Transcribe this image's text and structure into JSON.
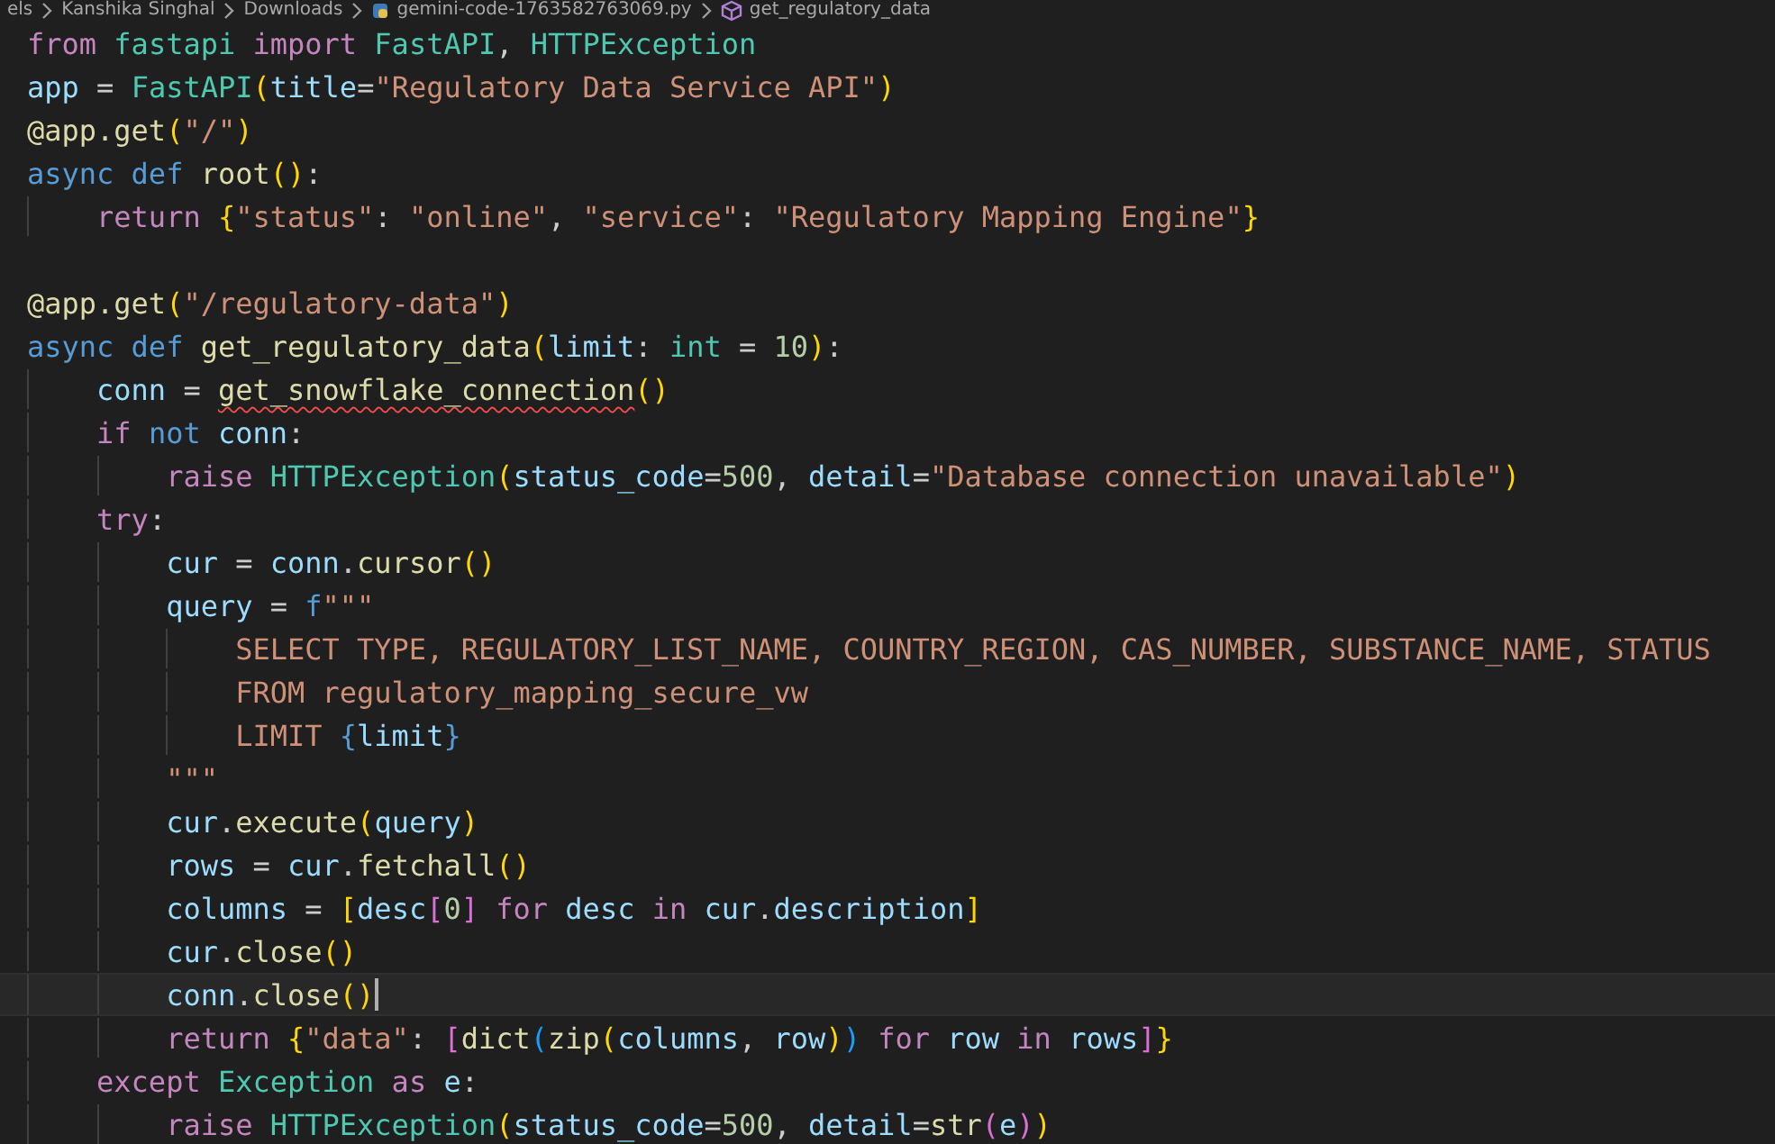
{
  "breadcrumb": [
    {
      "kind": "folder",
      "label": "els"
    },
    {
      "kind": "folder",
      "label": "Kanshika Singhal"
    },
    {
      "kind": "folder",
      "label": "Downloads"
    },
    {
      "kind": "file",
      "label": "gemini-code-1763582763069.py"
    },
    {
      "kind": "symbol",
      "label": "get_regulatory_data"
    }
  ],
  "editor": {
    "lines": [
      {
        "tokens": [
          {
            "kind": "kw",
            "text": "from "
          },
          {
            "kind": "ty",
            "text": "fastapi "
          },
          {
            "kind": "kw",
            "text": "import "
          },
          {
            "kind": "ty",
            "text": "FastAPI"
          },
          {
            "kind": "p",
            "text": ", "
          },
          {
            "kind": "ty",
            "text": "HTTPException"
          }
        ]
      },
      {
        "tokens": [
          {
            "kind": "var",
            "text": "app"
          },
          {
            "kind": "p",
            "text": " = "
          },
          {
            "kind": "ty",
            "text": "FastAPI"
          },
          {
            "kind": "b1",
            "text": "("
          },
          {
            "kind": "var",
            "text": "title"
          },
          {
            "kind": "p",
            "text": "="
          },
          {
            "kind": "str",
            "text": "\"Regulatory Data Service API\""
          },
          {
            "kind": "b1",
            "text": ")"
          }
        ]
      },
      {
        "tokens": [
          {
            "kind": "fn",
            "text": "@app.get"
          },
          {
            "kind": "b1",
            "text": "("
          },
          {
            "kind": "str",
            "text": "\"/\""
          },
          {
            "kind": "b1",
            "text": ")"
          }
        ]
      },
      {
        "tokens": [
          {
            "kind": "st",
            "text": "async def "
          },
          {
            "kind": "fn",
            "text": "root"
          },
          {
            "kind": "b1",
            "text": "()"
          },
          {
            "kind": "p",
            "text": ":"
          }
        ],
        "children": [
          {
            "tokens": [
              {
                "kind": "kw",
                "text": "return "
              },
              {
                "kind": "b1",
                "text": "{"
              },
              {
                "kind": "str",
                "text": "\"status\""
              },
              {
                "kind": "p",
                "text": ": "
              },
              {
                "kind": "str",
                "text": "\"online\""
              },
              {
                "kind": "p",
                "text": ", "
              },
              {
                "kind": "str",
                "text": "\"service\""
              },
              {
                "kind": "p",
                "text": ": "
              },
              {
                "kind": "str",
                "text": "\"Regulatory Mapping Engine\""
              },
              {
                "kind": "b1",
                "text": "}"
              }
            ]
          }
        ]
      },
      {
        "gap_before": true,
        "tokens": [
          {
            "kind": "fn",
            "text": "@app.get"
          },
          {
            "kind": "b1",
            "text": "("
          },
          {
            "kind": "str",
            "text": "\"/regulatory-data\""
          },
          {
            "kind": "b1",
            "text": ")"
          }
        ]
      },
      {
        "tokens": [
          {
            "kind": "st",
            "text": "async def "
          },
          {
            "kind": "fn",
            "text": "get_regulatory_data"
          },
          {
            "kind": "b1",
            "text": "("
          },
          {
            "kind": "var",
            "text": "limit"
          },
          {
            "kind": "p",
            "text": ": "
          },
          {
            "kind": "ty",
            "text": "int"
          },
          {
            "kind": "p",
            "text": " = "
          },
          {
            "kind": "num",
            "text": "10"
          },
          {
            "kind": "b1",
            "text": ")"
          },
          {
            "kind": "p",
            "text": ":"
          }
        ],
        "children": [
          {
            "tokens": [
              {
                "kind": "var",
                "text": "conn"
              },
              {
                "kind": "p",
                "text": " = "
              },
              {
                "kind": "fn",
                "text": "get_snowflake_connection",
                "squiggle": true
              },
              {
                "kind": "b1",
                "text": "()"
              }
            ]
          },
          {
            "tokens": [
              {
                "kind": "kw",
                "text": "if "
              },
              {
                "kind": "st",
                "text": "not "
              },
              {
                "kind": "var",
                "text": "conn"
              },
              {
                "kind": "p",
                "text": ":"
              }
            ],
            "children": [
              {
                "tokens": [
                  {
                    "kind": "kw",
                    "text": "raise "
                  },
                  {
                    "kind": "ty",
                    "text": "HTTPException"
                  },
                  {
                    "kind": "b1",
                    "text": "("
                  },
                  {
                    "kind": "var",
                    "text": "status_code"
                  },
                  {
                    "kind": "p",
                    "text": "="
                  },
                  {
                    "kind": "num",
                    "text": "500"
                  },
                  {
                    "kind": "p",
                    "text": ", "
                  },
                  {
                    "kind": "var",
                    "text": "detail"
                  },
                  {
                    "kind": "p",
                    "text": "="
                  },
                  {
                    "kind": "str",
                    "text": "\"Database connection unavailable\""
                  },
                  {
                    "kind": "b1",
                    "text": ")"
                  }
                ]
              }
            ]
          },
          {
            "tokens": [
              {
                "kind": "kw",
                "text": "try"
              },
              {
                "kind": "p",
                "text": ":"
              }
            ],
            "children": [
              {
                "tokens": [
                  {
                    "kind": "var",
                    "text": "cur"
                  },
                  {
                    "kind": "p",
                    "text": " = "
                  },
                  {
                    "kind": "var",
                    "text": "conn"
                  },
                  {
                    "kind": "p",
                    "text": "."
                  },
                  {
                    "kind": "fn",
                    "text": "cursor"
                  },
                  {
                    "kind": "b1",
                    "text": "()"
                  }
                ]
              },
              {
                "tokens": [
                  {
                    "kind": "var",
                    "text": "query"
                  },
                  {
                    "kind": "p",
                    "text": " = "
                  },
                  {
                    "kind": "st",
                    "text": "f"
                  },
                  {
                    "kind": "str",
                    "text": "\"\"\""
                  }
                ],
                "children": [
                  {
                    "tokens": [
                      {
                        "kind": "str",
                        "text": "SELECT TYPE, REGULATORY_LIST_NAME, COUNTRY_REGION, CAS_NUMBER, SUBSTANCE_NAME, STATUS"
                      }
                    ]
                  },
                  {
                    "tokens": [
                      {
                        "kind": "str",
                        "text": "FROM regulatory_mapping_secure_vw"
                      }
                    ]
                  },
                  {
                    "tokens": [
                      {
                        "kind": "str",
                        "text": "LIMIT "
                      },
                      {
                        "kind": "st",
                        "text": "{"
                      },
                      {
                        "kind": "var",
                        "text": "limit"
                      },
                      {
                        "kind": "st",
                        "text": "}"
                      }
                    ]
                  }
                ]
              },
              {
                "tokens": [
                  {
                    "kind": "str",
                    "text": "\"\"\""
                  }
                ]
              },
              {
                "tokens": [
                  {
                    "kind": "var",
                    "text": "cur"
                  },
                  {
                    "kind": "p",
                    "text": "."
                  },
                  {
                    "kind": "fn",
                    "text": "execute"
                  },
                  {
                    "kind": "b1",
                    "text": "("
                  },
                  {
                    "kind": "var",
                    "text": "query"
                  },
                  {
                    "kind": "b1",
                    "text": ")"
                  }
                ]
              },
              {
                "tokens": [
                  {
                    "kind": "var",
                    "text": "rows"
                  },
                  {
                    "kind": "p",
                    "text": " = "
                  },
                  {
                    "kind": "var",
                    "text": "cur"
                  },
                  {
                    "kind": "p",
                    "text": "."
                  },
                  {
                    "kind": "fn",
                    "text": "fetchall"
                  },
                  {
                    "kind": "b1",
                    "text": "()"
                  }
                ]
              },
              {
                "tokens": [
                  {
                    "kind": "var",
                    "text": "columns"
                  },
                  {
                    "kind": "p",
                    "text": " = "
                  },
                  {
                    "kind": "b1",
                    "text": "["
                  },
                  {
                    "kind": "var",
                    "text": "desc"
                  },
                  {
                    "kind": "b2",
                    "text": "["
                  },
                  {
                    "kind": "num",
                    "text": "0"
                  },
                  {
                    "kind": "b2",
                    "text": "]"
                  },
                  {
                    "kind": "kw",
                    "text": " for "
                  },
                  {
                    "kind": "var",
                    "text": "desc"
                  },
                  {
                    "kind": "kw",
                    "text": " in "
                  },
                  {
                    "kind": "var",
                    "text": "cur"
                  },
                  {
                    "kind": "p",
                    "text": "."
                  },
                  {
                    "kind": "var",
                    "text": "description"
                  },
                  {
                    "kind": "b1",
                    "text": "]"
                  }
                ]
              },
              {
                "tokens": [
                  {
                    "kind": "var",
                    "text": "cur"
                  },
                  {
                    "kind": "p",
                    "text": "."
                  },
                  {
                    "kind": "fn",
                    "text": "close"
                  },
                  {
                    "kind": "b1",
                    "text": "()"
                  }
                ]
              },
              {
                "current": true,
                "tokens": [
                  {
                    "kind": "var",
                    "text": "conn"
                  },
                  {
                    "kind": "p",
                    "text": "."
                  },
                  {
                    "kind": "fn",
                    "text": "close"
                  },
                  {
                    "kind": "b1",
                    "text": "()"
                  }
                ]
              },
              {
                "tokens": [
                  {
                    "kind": "kw",
                    "text": "return "
                  },
                  {
                    "kind": "b1",
                    "text": "{"
                  },
                  {
                    "kind": "str",
                    "text": "\"data\""
                  },
                  {
                    "kind": "p",
                    "text": ": "
                  },
                  {
                    "kind": "b2",
                    "text": "["
                  },
                  {
                    "kind": "fn",
                    "text": "dict"
                  },
                  {
                    "kind": "b3",
                    "text": "("
                  },
                  {
                    "kind": "fn",
                    "text": "zip"
                  },
                  {
                    "kind": "b1",
                    "text": "("
                  },
                  {
                    "kind": "var",
                    "text": "columns"
                  },
                  {
                    "kind": "p",
                    "text": ", "
                  },
                  {
                    "kind": "var",
                    "text": "row"
                  },
                  {
                    "kind": "b1",
                    "text": ")"
                  },
                  {
                    "kind": "b3",
                    "text": ")"
                  },
                  {
                    "kind": "kw",
                    "text": " for "
                  },
                  {
                    "kind": "var",
                    "text": "row"
                  },
                  {
                    "kind": "kw",
                    "text": " in "
                  },
                  {
                    "kind": "var",
                    "text": "rows"
                  },
                  {
                    "kind": "b2",
                    "text": "]"
                  },
                  {
                    "kind": "b1",
                    "text": "}"
                  }
                ]
              }
            ]
          },
          {
            "tokens": [
              {
                "kind": "kw",
                "text": "except "
              },
              {
                "kind": "ty",
                "text": "Exception"
              },
              {
                "kind": "kw",
                "text": " as "
              },
              {
                "kind": "var",
                "text": "e"
              },
              {
                "kind": "p",
                "text": ":"
              }
            ],
            "children": [
              {
                "tokens": [
                  {
                    "kind": "kw",
                    "text": "raise "
                  },
                  {
                    "kind": "ty",
                    "text": "HTTPException"
                  },
                  {
                    "kind": "b1",
                    "text": "("
                  },
                  {
                    "kind": "var",
                    "text": "status_code"
                  },
                  {
                    "kind": "p",
                    "text": "="
                  },
                  {
                    "kind": "num",
                    "text": "500"
                  },
                  {
                    "kind": "p",
                    "text": ", "
                  },
                  {
                    "kind": "var",
                    "text": "detail"
                  },
                  {
                    "kind": "p",
                    "text": "="
                  },
                  {
                    "kind": "fn",
                    "text": "str"
                  },
                  {
                    "kind": "b2",
                    "text": "("
                  },
                  {
                    "kind": "var",
                    "text": "e"
                  },
                  {
                    "kind": "b2",
                    "text": ")"
                  },
                  {
                    "kind": "b1",
                    "text": ")"
                  }
                ]
              }
            ]
          }
        ]
      }
    ]
  }
}
